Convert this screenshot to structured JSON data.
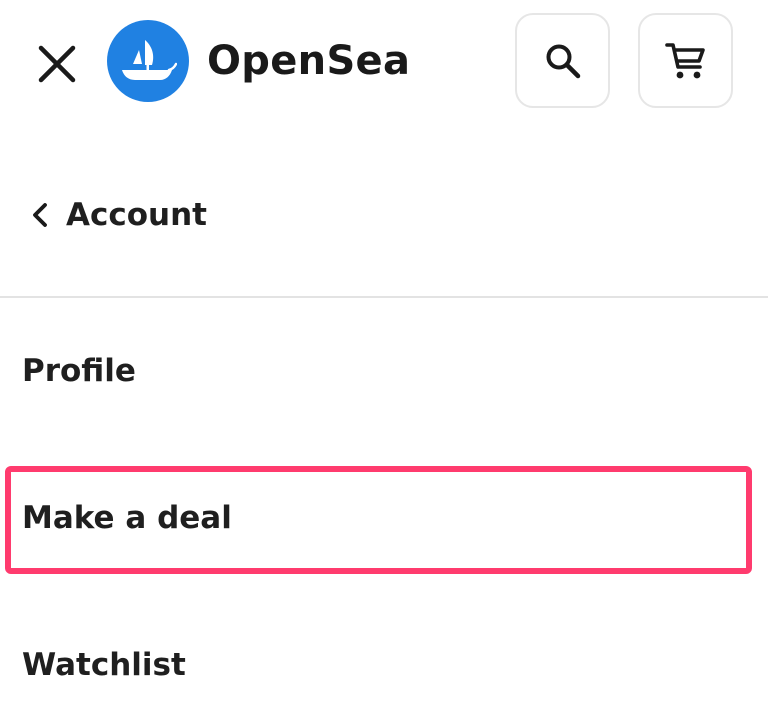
{
  "header": {
    "brand_name": "OpenSea",
    "close_icon": "close-icon",
    "logo_icon": "opensea-ship-icon",
    "search_icon": "search-icon",
    "cart_icon": "cart-icon"
  },
  "nav": {
    "back_icon": "chevron-left-icon",
    "back_label": "Account"
  },
  "menu": {
    "items": [
      {
        "label": "Profile"
      },
      {
        "label": "Make a deal"
      },
      {
        "label": "Watchlist"
      }
    ]
  },
  "colors": {
    "brand_blue": "#2081E2",
    "highlight": "#FF3B6E",
    "text": "#1F1F1F",
    "divider": "#E3E3E3"
  }
}
